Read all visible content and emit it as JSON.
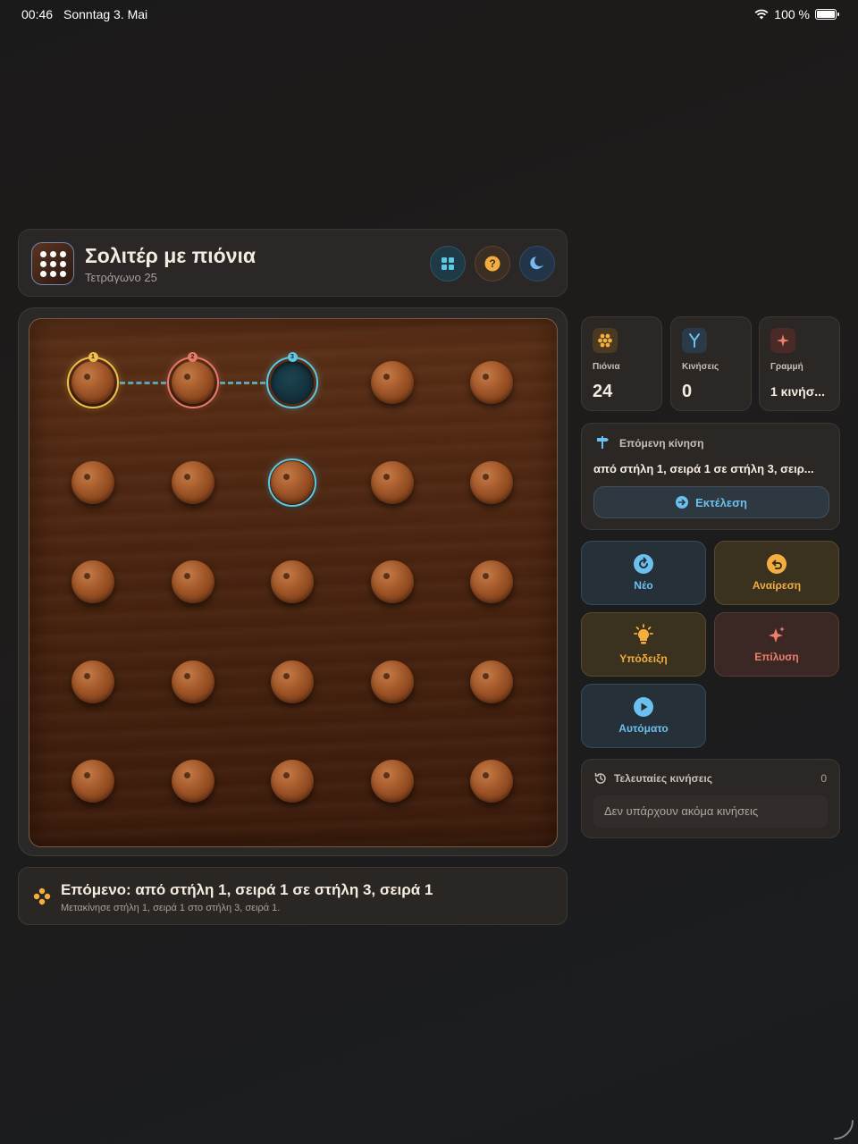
{
  "status": {
    "time": "00:46",
    "date": "Sonntag 3. Mai",
    "battery": "100 %"
  },
  "header": {
    "title": "Σολιτέρ με πιόνια",
    "subtitle": "Τετράγωνο 25",
    "buttons": [
      "grid-icon",
      "help-icon",
      "moon-icon"
    ]
  },
  "board": {
    "rows": 5,
    "cols": 5,
    "empty": [
      [
        0,
        2
      ]
    ],
    "path": [
      {
        "row": 0,
        "col": 0,
        "badge": "1",
        "color": "#f2c04a"
      },
      {
        "row": 0,
        "col": 1,
        "badge": "2",
        "color": "#e97a6a"
      },
      {
        "row": 0,
        "col": 2,
        "badge": "3",
        "color": "#5cc8e4"
      }
    ],
    "highlight": [
      {
        "row": 1,
        "col": 2,
        "color": "#5cc8e4"
      }
    ]
  },
  "next": {
    "title": "Επόμενο: από στήλη 1, σειρά 1 σε στήλη 3, σειρά 1",
    "subtitle": "Μετακίνησε στήλη 1, σειρά 1 στο στήλη 3, σειρά 1."
  },
  "stats": [
    {
      "label": "Πιόνια",
      "value": "24",
      "icon": "pegs-icon",
      "color": "#f4ae3f"
    },
    {
      "label": "Κινήσεις",
      "value": "0",
      "icon": "branch-icon",
      "color": "#6cc0ef"
    },
    {
      "label": "Γραμμή",
      "value": "1 κινήσ...",
      "icon": "sparkle-icon",
      "color": "#ee7f6b"
    }
  ],
  "move": {
    "heading": "Επόμενη κίνηση",
    "text": "από στήλη 1, σειρά 1 σε στήλη 3, σειρ...",
    "execute_label": "Εκτέλεση"
  },
  "actions": {
    "new_label": "Νέο",
    "undo_label": "Αναίρεση",
    "hint_label": "Υπόδειξη",
    "solve_label": "Επίλυση",
    "auto_label": "Αυτόματο"
  },
  "history": {
    "title": "Τελευταίες κινήσεις",
    "count": "0",
    "empty_text": "Δεν υπάρχουν ακόμα κινήσεις"
  }
}
